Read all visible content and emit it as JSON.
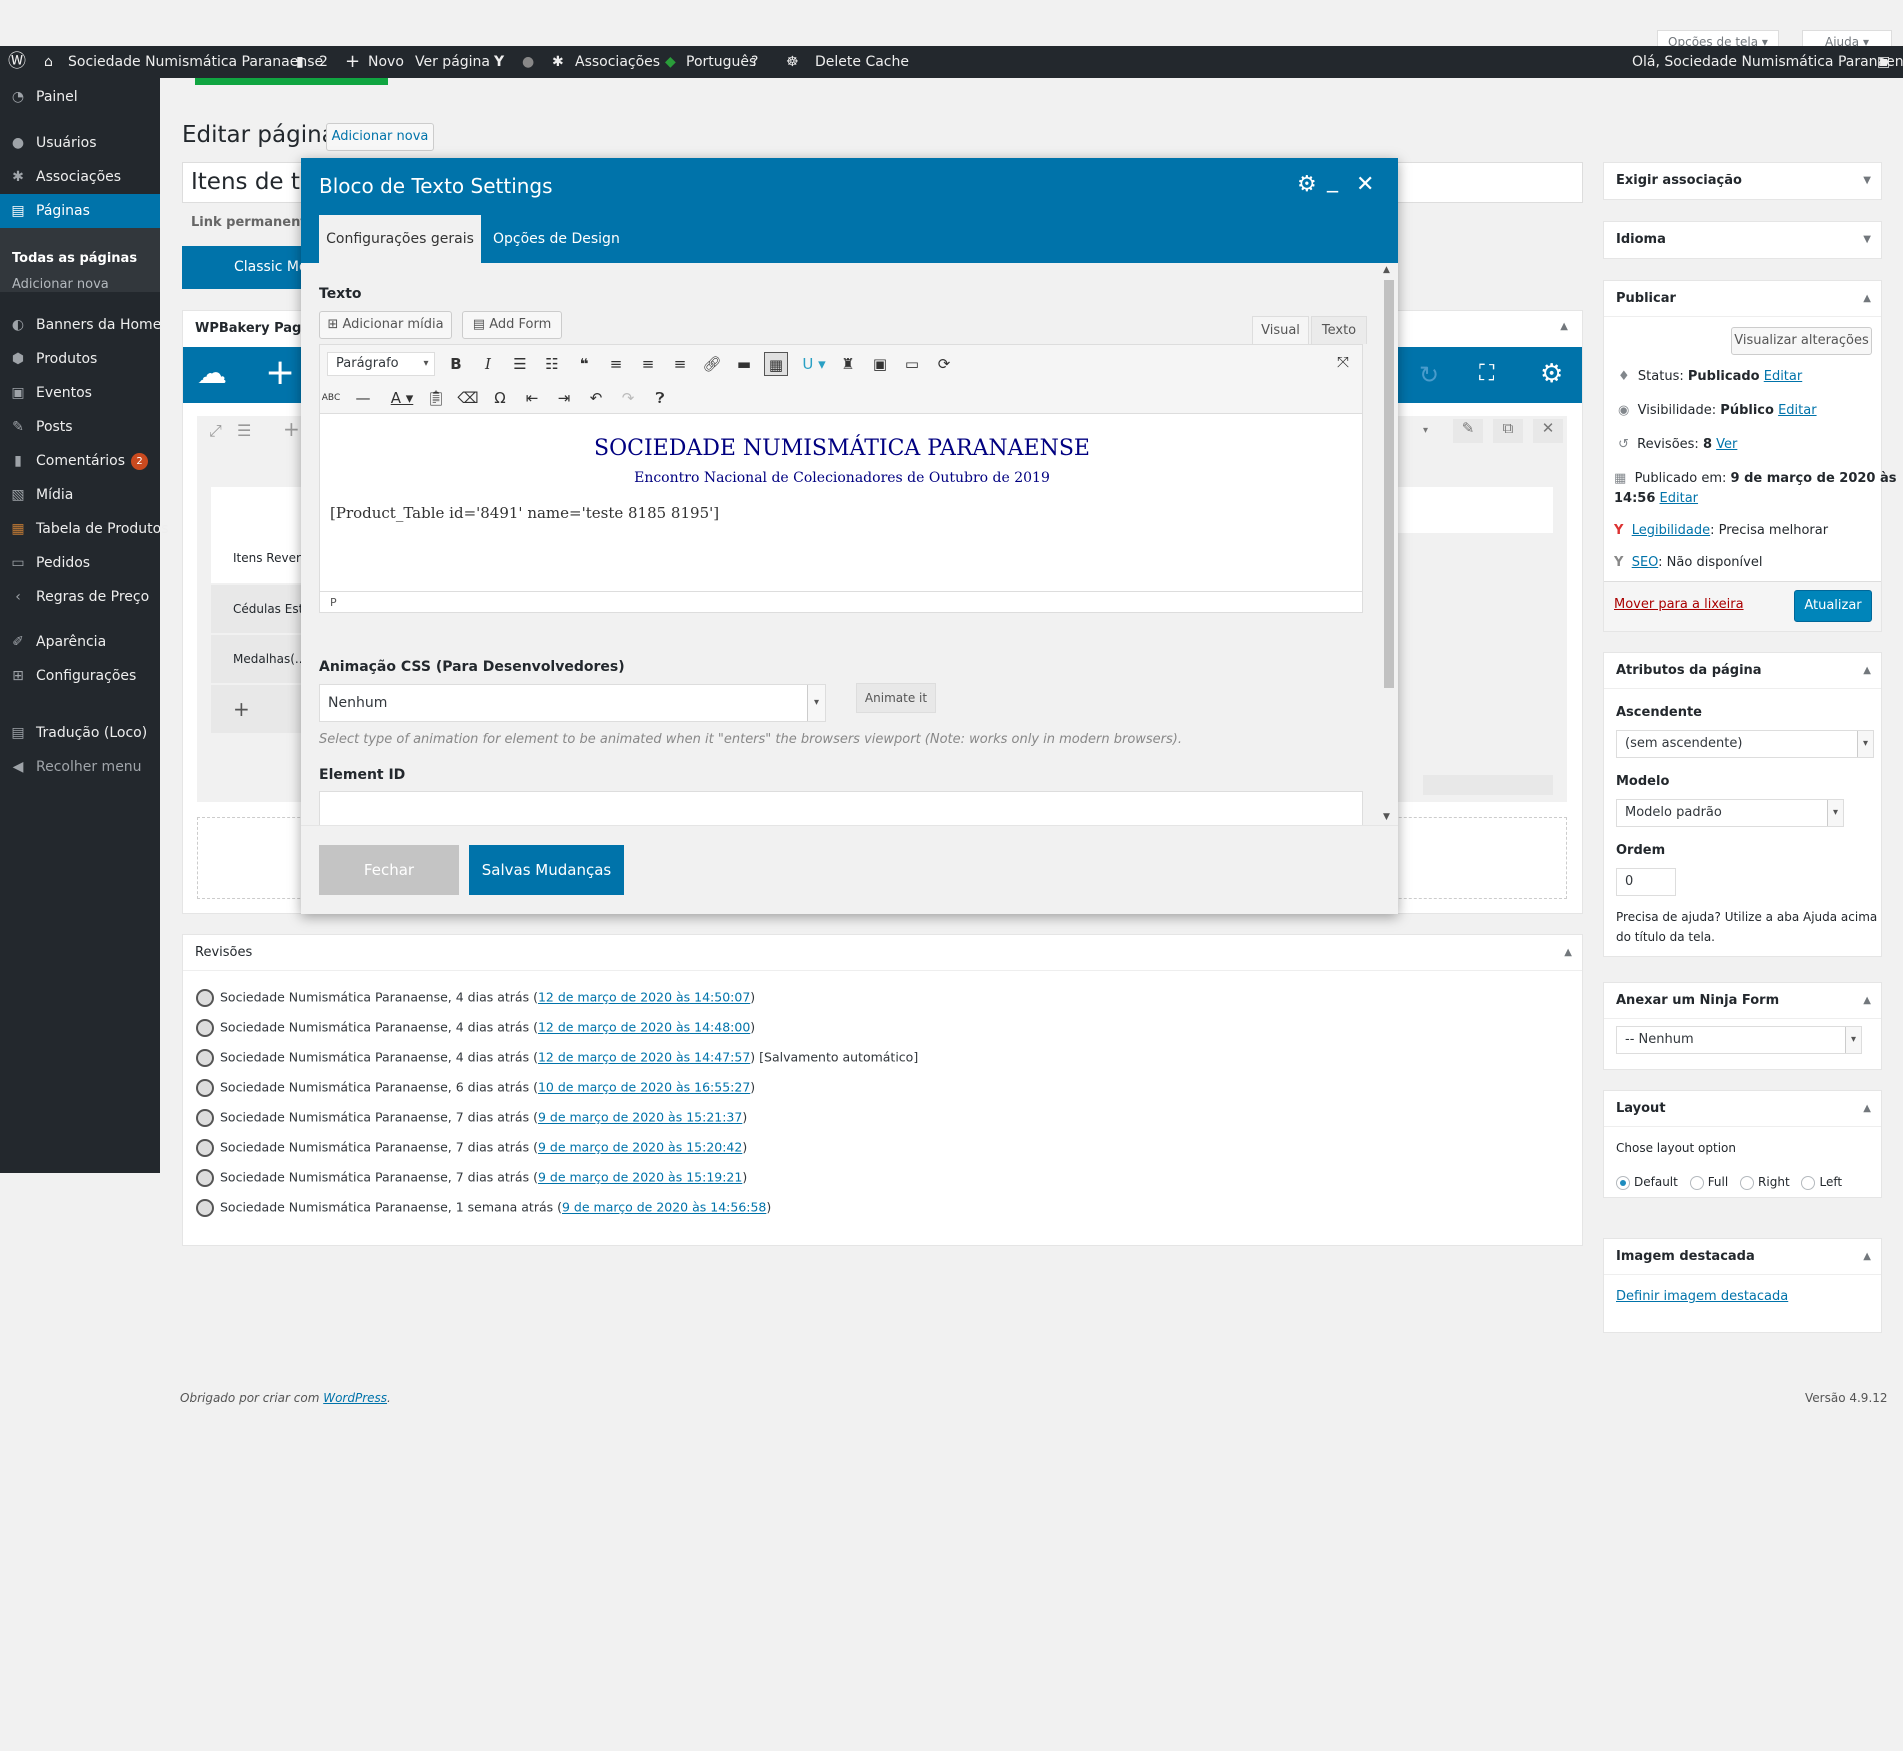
{
  "topbar": {
    "screen_options": "Opções de tela",
    "help": "Ajuda"
  },
  "adminbar": {
    "site": "Sociedade Numismática Paranaense",
    "comments": "2",
    "new": "Novo",
    "view_page": "Ver página",
    "associations": "Associações",
    "language": "Português",
    "delete_cache": "Delete Cache",
    "greeting": "Olá, Sociedade Numismática Paranaense"
  },
  "sidebar": {
    "items": [
      {
        "label": "Painel",
        "icon": "dashboard-icon"
      },
      {
        "label": "Usuários",
        "icon": "users-icon"
      },
      {
        "label": "Associações",
        "icon": "groups-icon"
      },
      {
        "label": "Páginas",
        "icon": "pages-icon"
      },
      {
        "label": "Banners da Home",
        "icon": "banners-icon"
      },
      {
        "label": "Produtos",
        "icon": "products-icon"
      },
      {
        "label": "Eventos",
        "icon": "events-icon"
      },
      {
        "label": "Posts",
        "icon": "pin-icon"
      },
      {
        "label": "Comentários",
        "icon": "comments-icon",
        "badge": "2"
      },
      {
        "label": "Mídia",
        "icon": "media-icon"
      },
      {
        "label": "Tabela de Produtos",
        "icon": "table-icon"
      },
      {
        "label": "Pedidos",
        "icon": "woo-icon"
      },
      {
        "label": "Regras de Preço",
        "icon": "price-rules-icon"
      },
      {
        "label": "Aparência",
        "icon": "appearance-icon"
      },
      {
        "label": "Configurações",
        "icon": "settings-icon"
      },
      {
        "label": "Tradução (Loco)",
        "icon": "loco-icon"
      },
      {
        "label": "Recolher menu",
        "icon": "collapse-icon"
      }
    ],
    "sub": [
      "Todas as páginas",
      "Adicionar nova"
    ]
  },
  "main": {
    "heading": "Editar página",
    "add_new": "Adicionar nova",
    "title_value": "Itens de troca",
    "permalink_label": "Link permanente:",
    "classic_mode": "Classic Mode",
    "wpbakery": "WPBakery Page Builder",
    "tabs": [
      "Itens Revertidos",
      "Cédulas Estrangeiras",
      "Medalhas(...)"
    ]
  },
  "modal": {
    "title": "Bloco de Texto Settings",
    "tabs": [
      "Configurações gerais",
      "Opções de Design"
    ],
    "text_label": "Texto",
    "add_media": "Adicionar mídia",
    "add_form": "Add Form",
    "visual": "Visual",
    "text": "Texto",
    "paragraph": "Parágrafo",
    "content": {
      "heading": "SOCIEDADE NUMISMÁTICA PARANAENSE",
      "subheading": "Encontro Nacional de Colecionadores de Outubro de 2019",
      "shortcode": "[Product_Table id='8491' name='teste 8185 8195']"
    },
    "path": "P",
    "css_anim_label": "Animação CSS (Para Desenvolvedores)",
    "css_anim_value": "Nenhum",
    "animate_btn": "Animate it",
    "anim_help": "Select type of animation for element to be animated when it \"enters\" the browsers viewport (Note: works only in modern browsers).",
    "element_id": "Element ID",
    "close": "Fechar",
    "save": "Salvas Mudanças"
  },
  "revisions": {
    "title": "Revisões",
    "rows": [
      {
        "who": "Sociedade Numismática Paranaense, 4 dias atrás (",
        "link": "12 de março de 2020 às 14:50:07",
        "after": ")"
      },
      {
        "who": "Sociedade Numismática Paranaense, 4 dias atrás (",
        "link": "12 de março de 2020 às 14:48:00",
        "after": ")"
      },
      {
        "who": "Sociedade Numismática Paranaense, 4 dias atrás (",
        "link": "12 de março de 2020 às 14:47:57",
        "after": ") [Salvamento automático]"
      },
      {
        "who": "Sociedade Numismática Paranaense, 6 dias atrás (",
        "link": "10 de março de 2020 às 16:55:27",
        "after": ")"
      },
      {
        "who": "Sociedade Numismática Paranaense, 7 dias atrás (",
        "link": "9 de março de 2020 às 15:21:37",
        "after": ")"
      },
      {
        "who": "Sociedade Numismática Paranaense, 7 dias atrás (",
        "link": "9 de março de 2020 às 15:20:42",
        "after": ")"
      },
      {
        "who": "Sociedade Numismática Paranaense, 7 dias atrás (",
        "link": "9 de março de 2020 às 15:19:21",
        "after": ")"
      },
      {
        "who": "Sociedade Numismática Paranaense, 1 semana atrás (",
        "link": "9 de março de 2020 às 14:56:58",
        "after": ")"
      }
    ]
  },
  "side": {
    "exigir": "Exigir associação",
    "idioma": "Idioma",
    "publish": {
      "title": "Publicar",
      "preview": "Visualizar alterações",
      "status_label": "Status:",
      "status": "Publicado",
      "edit": "Editar",
      "vis_label": "Visibilidade:",
      "vis": "Público",
      "rev_label": "Revisões:",
      "rev": "8",
      "rev_link": "Ver",
      "pub_label": "Publicado em:",
      "pub": "9 de março de 2020 às",
      "pub2": "14:56",
      "legib": "Legibilidade",
      "legib_val": ": Precisa melhorar",
      "seo": "SEO",
      "seo_val": ": Não disponível",
      "trash": "Mover para a lixeira",
      "update": "Atualizar"
    },
    "attrs": {
      "title": "Atributos da página",
      "parent_label": "Ascendente",
      "parent": "(sem ascendente)",
      "model_label": "Modelo",
      "model": "Modelo padrão",
      "order_label": "Ordem",
      "order": "0",
      "help": "Precisa de ajuda? Utilize a aba Ajuda acima",
      "help2": "do título da tela."
    },
    "ninja": {
      "title": "Anexar um Ninja Form",
      "value": "-- Nenhum"
    },
    "layout": {
      "title": "Layout",
      "label": "Chose layout option",
      "options": [
        "Default",
        "Full",
        "Right",
        "Left"
      ]
    },
    "thumb": {
      "title": "Imagem destacada",
      "link": "Definir imagem destacada"
    }
  },
  "footer": {
    "thanks": "Obrigado por criar com ",
    "wp": "WordPress",
    "dot": ".",
    "version": "Versão 4.9.12"
  }
}
